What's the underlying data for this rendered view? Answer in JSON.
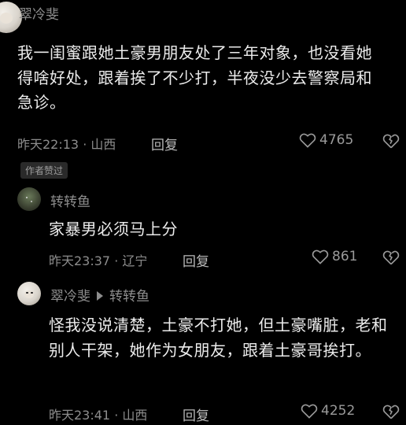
{
  "comments": [
    {
      "username": "翠冷斐",
      "content": "我一闺蜜跟她土豪男朋友处了三年对象，也没看她得啥好处，跟着挨了不少打，半夜没少去警察局和急诊。",
      "time_location": "昨天22:13 · 山西",
      "reply_label": "回复",
      "likes": "4765",
      "badge": "作者赞过"
    },
    {
      "username": "转转鱼",
      "content": "家暴男必须马上分",
      "time_location": "昨天23:37 · 辽宁",
      "reply_label": "回复",
      "likes": "861"
    },
    {
      "username": "翠冷斐",
      "reply_to": "转转鱼",
      "content": "怪我没说清楚，土豪不打她，但土豪嘴脏，老和别人干架，她作为女朋友，跟着土豪哥挨打。",
      "time_location": "昨天23:41 · 山西",
      "reply_label": "回复",
      "likes": "4252"
    }
  ],
  "colors": {
    "background": "#000000",
    "text": "#ececec",
    "muted": "#8d8d8d"
  },
  "icons": [
    "heart-outline-icon",
    "broken-heart-icon",
    "reply-arrow-icon"
  ]
}
